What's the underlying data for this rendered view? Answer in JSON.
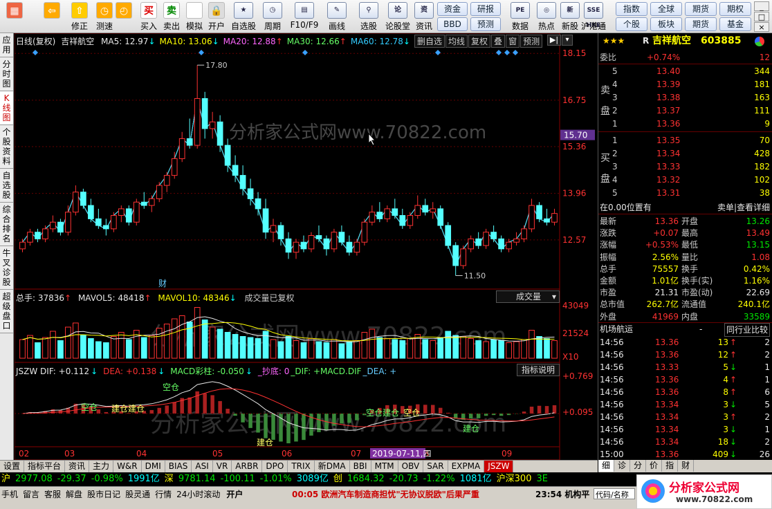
{
  "toolbar": {
    "buttons": [
      {
        "label": "",
        "icon": "grid-icon"
      },
      {
        "label": "",
        "icon": "back-arrow-icon"
      },
      {
        "label": "修正",
        "icon": "up-arrow-icon"
      },
      {
        "label": "测速",
        "icon": "speed-icon"
      },
      {
        "label": "",
        "icon": "clock-icon"
      },
      {
        "label": "买入",
        "icon": "buy-icon",
        "glyph": "买"
      },
      {
        "label": "卖出",
        "icon": "sell-icon",
        "glyph": "卖"
      },
      {
        "label": "模拟",
        "icon": "hammer-icon"
      },
      {
        "label": "开户",
        "icon": "lock-icon"
      }
    ],
    "wide_buttons": [
      {
        "label": "自选股",
        "icon": "star-icon"
      },
      {
        "label": "周期",
        "icon": "cycle-icon"
      },
      {
        "label": "F10/F9",
        "icon": "f10-icon"
      },
      {
        "label": "画线",
        "icon": "pen-icon"
      },
      {
        "label": "选股",
        "icon": "filter-icon"
      },
      {
        "label": "论股堂",
        "icon": "forum-icon"
      },
      {
        "label": "资讯",
        "icon": "news-icon"
      }
    ],
    "small_buttons": [
      "资金",
      "研报",
      "BBD",
      "预测"
    ],
    "right_icons": [
      {
        "label": "数据",
        "glyph": "PE"
      },
      {
        "label": "热点",
        "glyph": "◎"
      },
      {
        "label": "新股",
        "glyph": "新"
      },
      {
        "label": "沪港通",
        "glyph": "SSE HKE"
      }
    ],
    "market_buttons": [
      "指数",
      "全球",
      "期货",
      "期权",
      "个股",
      "板块",
      "期货",
      "基金"
    ],
    "win_controls": [
      "_",
      "□",
      "×"
    ]
  },
  "left_tabs": [
    {
      "label": "应用",
      "selected": false
    },
    {
      "label": "分时图",
      "selected": false
    },
    {
      "label": "K线图",
      "selected": true
    },
    {
      "label": "个股资料",
      "selected": false
    },
    {
      "label": "自选股",
      "selected": false
    },
    {
      "label": "综合排名",
      "selected": false
    },
    {
      "label": "牛叉诊股",
      "selected": false
    },
    {
      "label": "超级盘口",
      "selected": false
    }
  ],
  "kline_header": {
    "prefix": "日线(复权)",
    "name": "吉祥航空",
    "ma": [
      {
        "label": "MA5: 12.97",
        "arrow": "↓",
        "color": "#e8e8e8"
      },
      {
        "label": "MA10: 13.06",
        "arrow": "↓",
        "color": "#ffff00"
      },
      {
        "label": "MA20: 12.88",
        "arrow": "↑",
        "color": "#ff66ff"
      },
      {
        "label": "MA30: 12.66",
        "arrow": "↑",
        "color": "#66ff66"
      },
      {
        "label": "MA60: 12.78",
        "arrow": "↓",
        "color": "#33ccff"
      }
    ],
    "buttons": [
      "删自选",
      "均线",
      "复权",
      "叠",
      "窗",
      "预测"
    ]
  },
  "price_axis": {
    "ticks": [
      "18.15",
      "16.75",
      "15.36",
      "13.96",
      "12.57"
    ],
    "current": "15.70"
  },
  "annotations": {
    "high": "17.80",
    "low": "11.50",
    "event": "财",
    "watermark": "分析家公式网www.70822.com"
  },
  "volume_header": {
    "total": "总手: 37836",
    "total_arrow": "↑",
    "mavol5": "MAVOL5: 48418",
    "mavol5_arrow": "↑",
    "mavol10": "MAVOL10: 48346",
    "mavol10_arrow": "↓",
    "note": "成交量已复权",
    "dropdown": "成交量",
    "ticks": [
      "43049",
      "21524",
      "X10"
    ]
  },
  "macd_header": {
    "items": [
      {
        "label": "JSZW DIF: +0.112",
        "arrow": "↓",
        "color": "#e8e8e8"
      },
      {
        "label": "DEA: +0.138",
        "arrow": "↓",
        "color": "#ff3232"
      },
      {
        "label": "MACD彩柱: -0.050",
        "arrow": "↓",
        "color": "#66ff66"
      },
      {
        "label": "_抄底: 0",
        "color": "#ff66ff"
      },
      {
        "label": "_DIF: +MACD.DIF",
        "color": "#66ff66"
      },
      {
        "label": "_DEA: +",
        "color": "#66ccff"
      }
    ],
    "button": "指标说明",
    "ticks": [
      "+0.769",
      "+0.095"
    ],
    "labels": [
      "空仓",
      "建仓建仓",
      "空仓",
      "建仓",
      "空仓建仓",
      "空仓",
      "建仓"
    ]
  },
  "date_axis": {
    "labels": [
      "02",
      "03",
      "04",
      "05",
      "06",
      "07",
      "08",
      "09"
    ],
    "highlight": "2019-07-11,四"
  },
  "chart_data": {
    "type": "candlestick",
    "dates_visible": [
      "02",
      "03",
      "04",
      "05",
      "06",
      "07",
      "08",
      "09"
    ],
    "candles": [
      [
        12.3,
        12.6,
        12.2,
        12.5
      ],
      [
        12.5,
        12.9,
        12.4,
        12.8
      ],
      [
        12.8,
        12.9,
        12.5,
        12.6
      ],
      [
        12.6,
        13.0,
        12.5,
        12.9
      ],
      [
        12.9,
        13.3,
        12.8,
        13.1
      ],
      [
        13.1,
        13.2,
        12.7,
        12.8
      ],
      [
        12.8,
        13.6,
        12.7,
        13.4
      ],
      [
        13.4,
        14.2,
        13.3,
        14.0
      ],
      [
        14.0,
        14.1,
        13.5,
        13.6
      ],
      [
        13.6,
        13.8,
        13.1,
        13.2
      ],
      [
        13.2,
        13.5,
        12.9,
        13.0
      ],
      [
        13.0,
        13.2,
        12.7,
        12.9
      ],
      [
        12.9,
        13.4,
        12.8,
        13.3
      ],
      [
        13.3,
        13.6,
        13.1,
        13.5
      ],
      [
        13.5,
        13.6,
        13.0,
        13.1
      ],
      [
        13.1,
        13.8,
        13.0,
        13.7
      ],
      [
        13.7,
        14.0,
        13.5,
        13.6
      ],
      [
        13.6,
        13.9,
        13.4,
        13.8
      ],
      [
        13.8,
        14.3,
        13.7,
        14.2
      ],
      [
        14.2,
        14.6,
        14.0,
        14.5
      ],
      [
        14.5,
        15.2,
        14.4,
        15.0
      ],
      [
        15.0,
        15.8,
        14.9,
        15.6
      ],
      [
        15.6,
        16.2,
        15.3,
        15.4
      ],
      [
        15.4,
        17.8,
        15.3,
        16.8
      ],
      [
        16.8,
        17.0,
        15.6,
        15.9
      ],
      [
        15.9,
        16.4,
        15.6,
        16.1
      ],
      [
        16.1,
        16.3,
        15.2,
        15.4
      ],
      [
        15.4,
        15.6,
        14.6,
        14.8
      ],
      [
        14.8,
        15.1,
        14.3,
        14.5
      ],
      [
        14.5,
        14.8,
        13.9,
        14.1
      ],
      [
        14.1,
        14.4,
        13.6,
        13.8
      ],
      [
        13.8,
        14.0,
        13.3,
        13.5
      ],
      [
        13.5,
        13.8,
        12.6,
        12.8
      ],
      [
        12.8,
        13.2,
        12.5,
        13.0
      ],
      [
        13.0,
        13.1,
        12.4,
        12.6
      ],
      [
        12.6,
        12.8,
        12.0,
        12.2
      ],
      [
        12.2,
        12.6,
        12.0,
        12.5
      ],
      [
        12.5,
        12.7,
        12.2,
        12.3
      ],
      [
        12.3,
        12.8,
        12.2,
        12.7
      ],
      [
        12.7,
        13.0,
        12.5,
        12.6
      ],
      [
        12.6,
        12.7,
        12.1,
        12.3
      ],
      [
        12.3,
        12.9,
        12.2,
        12.8
      ],
      [
        12.8,
        13.0,
        12.4,
        12.5
      ],
      [
        12.5,
        12.7,
        12.1,
        12.2
      ],
      [
        12.2,
        12.6,
        12.1,
        12.5
      ],
      [
        12.5,
        13.2,
        12.4,
        13.1
      ],
      [
        13.1,
        13.6,
        13.0,
        13.4
      ],
      [
        13.4,
        13.7,
        13.1,
        13.2
      ],
      [
        13.2,
        13.6,
        13.1,
        13.5
      ],
      [
        13.5,
        13.8,
        13.2,
        13.3
      ],
      [
        13.3,
        13.5,
        12.9,
        13.0
      ],
      [
        13.0,
        13.4,
        12.9,
        13.3
      ],
      [
        13.3,
        13.9,
        13.2,
        13.6
      ],
      [
        13.6,
        13.8,
        13.3,
        13.4
      ],
      [
        13.4,
        13.7,
        13.2,
        13.5
      ],
      [
        13.5,
        13.6,
        12.9,
        13.0
      ],
      [
        13.0,
        13.1,
        12.3,
        12.4
      ],
      [
        12.4,
        12.5,
        11.5,
        11.8
      ],
      [
        11.8,
        12.4,
        11.7,
        12.3
      ],
      [
        12.3,
        12.7,
        12.2,
        12.6
      ],
      [
        12.6,
        12.8,
        12.3,
        12.4
      ],
      [
        12.4,
        12.9,
        12.3,
        12.8
      ],
      [
        12.8,
        13.0,
        12.5,
        12.6
      ],
      [
        12.6,
        12.7,
        12.2,
        12.3
      ],
      [
        12.3,
        12.6,
        12.2,
        12.5
      ],
      [
        12.5,
        12.8,
        12.4,
        12.6
      ],
      [
        12.6,
        13.0,
        12.5,
        12.9
      ],
      [
        12.9,
        13.8,
        12.8,
        13.6
      ],
      [
        13.6,
        13.7,
        13.1,
        13.2
      ],
      [
        13.2,
        13.5,
        13.0,
        13.1
      ],
      [
        13.1,
        13.5,
        13.0,
        13.36
      ]
    ],
    "volume": [
      18,
      22,
      15,
      20,
      26,
      17,
      30,
      34,
      22,
      19,
      16,
      15,
      21,
      25,
      18,
      27,
      20,
      22,
      29,
      33,
      38,
      41,
      35,
      49,
      37,
      30,
      28,
      25,
      23,
      21,
      20,
      19,
      26,
      18,
      16,
      21,
      17,
      15,
      19,
      16,
      15,
      18,
      14,
      16,
      17,
      25,
      28,
      20,
      19,
      18,
      17,
      19,
      23,
      18,
      17,
      20,
      26,
      22,
      21,
      19,
      17,
      16,
      18,
      17,
      15,
      16,
      18,
      27,
      21,
      19,
      17
    ],
    "units": {
      "volume": "手(×1000)"
    }
  },
  "quote": {
    "rating": "★★★",
    "code_prefix": "R",
    "name": "吉祥航空",
    "code": "603885",
    "weibi_label": "委比",
    "weibi": "+0.74%",
    "weicha": "12",
    "sell_label": [
      "卖",
      "盘"
    ],
    "buy_label": [
      "买",
      "盘"
    ],
    "sell": [
      {
        "lvl": "5",
        "price": "13.40",
        "vol": "344"
      },
      {
        "lvl": "4",
        "price": "13.39",
        "vol": "181"
      },
      {
        "lvl": "3",
        "price": "13.38",
        "vol": "163"
      },
      {
        "lvl": "2",
        "price": "13.37",
        "vol": "111"
      },
      {
        "lvl": "1",
        "price": "13.36",
        "vol": "9"
      }
    ],
    "buy": [
      {
        "lvl": "1",
        "price": "13.35",
        "vol": "70"
      },
      {
        "lvl": "2",
        "price": "13.34",
        "vol": "428"
      },
      {
        "lvl": "3",
        "price": "13.33",
        "vol": "182"
      },
      {
        "lvl": "4",
        "price": "13.32",
        "vol": "102"
      },
      {
        "lvl": "5",
        "price": "13.31",
        "vol": "38"
      }
    ],
    "position_label": "在0.00位置有",
    "position_right": "卖单|查看详细",
    "stats": [
      {
        "l1": "最新",
        "v1": "13.36",
        "c1": "red",
        "l2": "开盘",
        "v2": "13.26",
        "c2": "green"
      },
      {
        "l1": "涨跌",
        "v1": "+0.07",
        "c1": "red",
        "l2": "最高",
        "v2": "13.49",
        "c2": "red"
      },
      {
        "l1": "涨幅",
        "v1": "+0.53%",
        "c1": "red",
        "l2": "最低",
        "v2": "13.15",
        "c2": "green"
      },
      {
        "l1": "振幅",
        "v1": "2.56%",
        "c1": "yellow",
        "l2": "量比",
        "v2": "1.08",
        "c2": "red"
      },
      {
        "l1": "总手",
        "v1": "75557",
        "c1": "yellow",
        "l2": "换手",
        "v2": "0.42%",
        "c2": "yellow"
      },
      {
        "l1": "金额",
        "v1": "1.01亿",
        "c1": "yellow",
        "l2": "换手(实)",
        "v2": "1.16%",
        "c2": "yellow"
      },
      {
        "l1": "市盈",
        "v1": "21.31",
        "c1": "white",
        "l2": "市盈(动)",
        "v2": "22.69",
        "c2": "white"
      },
      {
        "l1": "总市值",
        "v1": "262.7亿",
        "c1": "yellow",
        "l2": "流通值",
        "v2": "240.1亿",
        "c2": "yellow"
      },
      {
        "l1": "外盘",
        "v1": "41969",
        "c1": "red",
        "l2": "内盘",
        "v2": "33589",
        "c2": "green"
      }
    ],
    "industry": "机场航运",
    "industry_dash": "-",
    "compare": "同行业比较",
    "ticks": [
      {
        "t": "14:56",
        "p": "13.36",
        "pc": "red",
        "v": "13",
        "a": "↑",
        "vc": "red",
        "n": "2"
      },
      {
        "t": "14:56",
        "p": "13.36",
        "pc": "red",
        "v": "12",
        "a": "↑",
        "vc": "red",
        "n": "2"
      },
      {
        "t": "14:56",
        "p": "13.33",
        "pc": "red",
        "v": "5",
        "a": "↓",
        "vc": "green",
        "n": "1"
      },
      {
        "t": "14:56",
        "p": "13.36",
        "pc": "red",
        "v": "4",
        "a": "↑",
        "vc": "red",
        "n": "1"
      },
      {
        "t": "14:56",
        "p": "13.36",
        "pc": "red",
        "v": "8",
        "a": "↑",
        "vc": "red",
        "n": "6"
      },
      {
        "t": "14:56",
        "p": "13.34",
        "pc": "red",
        "v": "3",
        "a": "↓",
        "vc": "green",
        "n": "5"
      },
      {
        "t": "14:56",
        "p": "13.34",
        "pc": "red",
        "v": "3",
        "a": "↑",
        "vc": "red",
        "n": "2"
      },
      {
        "t": "14:56",
        "p": "13.34",
        "pc": "red",
        "v": "3",
        "a": "↓",
        "vc": "green",
        "n": "1"
      },
      {
        "t": "14:56",
        "p": "13.34",
        "pc": "red",
        "v": "18",
        "a": "↓",
        "vc": "green",
        "n": "2"
      },
      {
        "t": "15:00",
        "p": "13.36",
        "pc": "red",
        "v": "409",
        "a": "↓",
        "vc": "green",
        "n": "26"
      }
    ],
    "bottom_tabs": [
      "细",
      "诊",
      "分",
      "价",
      "指",
      "财"
    ]
  },
  "bottom_tabs": [
    "设置",
    "指标平台",
    "资讯",
    "主力",
    "W&R",
    "DMI",
    "BIAS",
    "ASI",
    "VR",
    "ARBR",
    "DPO",
    "TRIX",
    "新DMA",
    "BBI",
    "MTM",
    "OBV",
    "SAR",
    "EXPMA",
    "JSZW"
  ],
  "index_bar": [
    {
      "t": "沪",
      "c": "yellow"
    },
    {
      "t": "2977.08",
      "c": "green"
    },
    {
      "t": "-29.37",
      "c": "green"
    },
    {
      "t": "-0.98%",
      "c": "green"
    },
    {
      "t": "1991亿",
      "c": "cyan"
    },
    {
      "t": "深",
      "c": "yellow"
    },
    {
      "t": "9781.14",
      "c": "green"
    },
    {
      "t": "-100.11",
      "c": "green"
    },
    {
      "t": "-1.01%",
      "c": "green"
    },
    {
      "t": "3089亿",
      "c": "cyan"
    },
    {
      "t": "创",
      "c": "yellow"
    },
    {
      "t": "1684.32",
      "c": "green"
    },
    {
      "t": "-20.73",
      "c": "green"
    },
    {
      "t": "-1.22%",
      "c": "green"
    },
    {
      "t": "1081亿",
      "c": "cyan"
    },
    {
      "t": "沪深300",
      "c": "yellow"
    },
    {
      "t": "3E",
      "c": "green"
    }
  ],
  "status": {
    "items": [
      "手机",
      "留言",
      "客服",
      "解盘",
      "股市日记",
      "股灵通",
      "行情",
      "24小时滚动"
    ],
    "open": "开户",
    "news": "00:05 欧洲汽车制造商担忧\"无协议脱欧\"后果严重",
    "time": "23:54 机构平",
    "code_label": "代码/名称",
    "logo": "分析家公式网",
    "logo_url": "www.70822.com"
  }
}
